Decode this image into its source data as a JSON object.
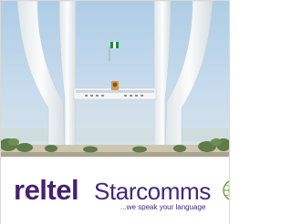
{
  "banner": {
    "brand_primary": "reltel",
    "brand_secondary": "Starcomms",
    "tagline": "...we speak your language",
    "logo_icon": "globe-icon"
  },
  "photo": {
    "subject": "city-gate-monument-photo"
  },
  "colors": {
    "brand_purple": "#45226e",
    "sky": "#b9d4e8",
    "monument": "#f4f6f6",
    "border": "#d9d9d9"
  }
}
